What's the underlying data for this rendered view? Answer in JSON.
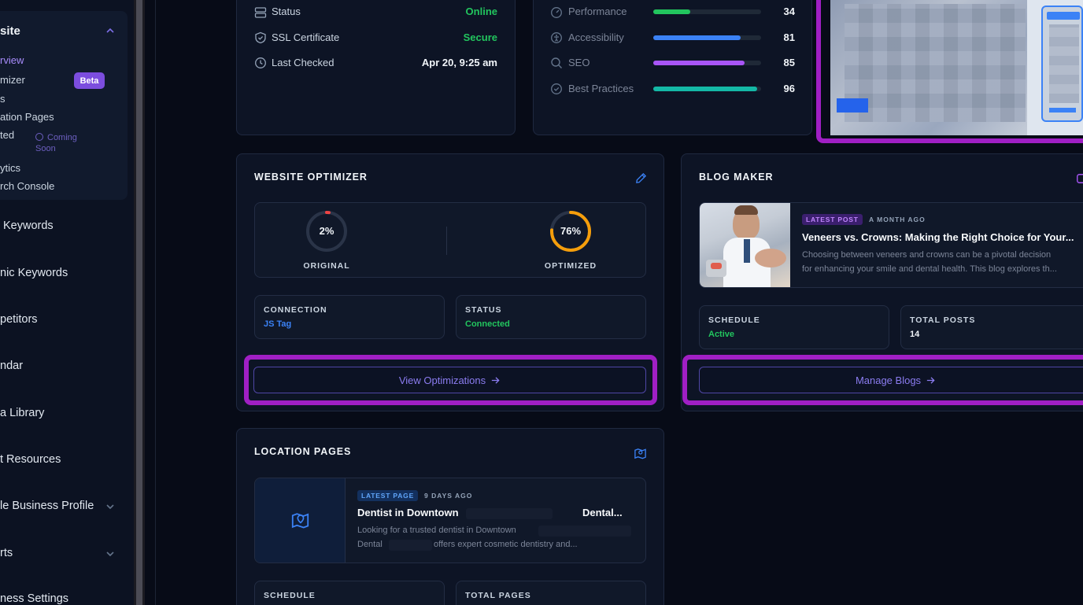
{
  "sidebar": {
    "section_title": "site",
    "items": [
      {
        "label": "rview"
      },
      {
        "label": "mizer"
      },
      {
        "label": "s"
      },
      {
        "label": "ation Pages"
      },
      {
        "label": "ted"
      },
      {
        "label": "ytics"
      },
      {
        "label": "rch Console"
      }
    ],
    "beta_badge": "Beta",
    "coming_soon_line1": "Coming",
    "coming_soon_line2": "Soon",
    "main_items": [
      {
        "label": "Keywords"
      },
      {
        "label": "nic Keywords"
      },
      {
        "label": "petitors"
      },
      {
        "label": "ndar"
      },
      {
        "label": "a Library"
      },
      {
        "label": "t Resources"
      },
      {
        "label": "le Business Profile"
      },
      {
        "label": "rts"
      },
      {
        "label": "ness Settings"
      }
    ]
  },
  "status_card": {
    "rows": [
      {
        "label": "Status",
        "value": "Online",
        "color": "#22c55e"
      },
      {
        "label": "SSL Certificate",
        "value": "Secure",
        "color": "#22c55e"
      },
      {
        "label": "Last Checked",
        "value": "Apr 20, 9:25 am",
        "color": "#f1f5f9"
      }
    ]
  },
  "performance_card": {
    "metrics": [
      {
        "label": "Performance",
        "score": "34",
        "fraction": 0.34,
        "color": "#22c55e"
      },
      {
        "label": "Accessibility",
        "score": "81",
        "fraction": 0.81,
        "color": "#3b82f6"
      },
      {
        "label": "SEO",
        "score": "85",
        "fraction": 0.85,
        "color": "#a855f7"
      },
      {
        "label": "Best Practices",
        "score": "96",
        "fraction": 0.96,
        "color": "#14b8a6"
      }
    ]
  },
  "optimizer_card": {
    "title": "WEBSITE OPTIMIZER",
    "original_value": "2%",
    "original_fraction": 0.02,
    "original_label": "ORIGINAL",
    "optimized_value": "76%",
    "optimized_fraction": 0.76,
    "optimized_label": "OPTIMIZED",
    "connection_label": "CONNECTION",
    "connection_value": "JS Tag",
    "status_label": "STATUS",
    "status_value": "Connected",
    "button_label": "View Optimizations",
    "colors": {
      "original": "#ef4444",
      "optimized": "#f59e0b",
      "connection": "#3b82f6",
      "status": "#22c55e"
    }
  },
  "blog_card": {
    "title": "BLOG MAKER",
    "latest_tag": "LATEST POST",
    "time_ago": "A MONTH AGO",
    "post_title": "Veneers vs. Crowns: Making the Right Choice for Your...",
    "post_line1": "Choosing between veneers and crowns can be a pivotal decision",
    "post_line2": "for enhancing your smile and dental health. This blog explores th...",
    "schedule_label": "SCHEDULE",
    "schedule_value": "Active",
    "total_label": "TOTAL POSTS",
    "total_value": "14",
    "button_label": "Manage Blogs"
  },
  "location_card": {
    "title": "LOCATION PAGES",
    "latest_tag": "LATEST PAGE",
    "time_ago": "9 DAYS AGO",
    "page_title_a": "Dentist in Downtown",
    "page_title_b": "Dental...",
    "body_line1": "Looking for a trusted dentist in Downtown",
    "body_line2a": "Dental",
    "body_line2b": "offers expert cosmetic dentistry and...",
    "schedule_label": "SCHEDULE",
    "total_label": "TOTAL PAGES"
  }
}
